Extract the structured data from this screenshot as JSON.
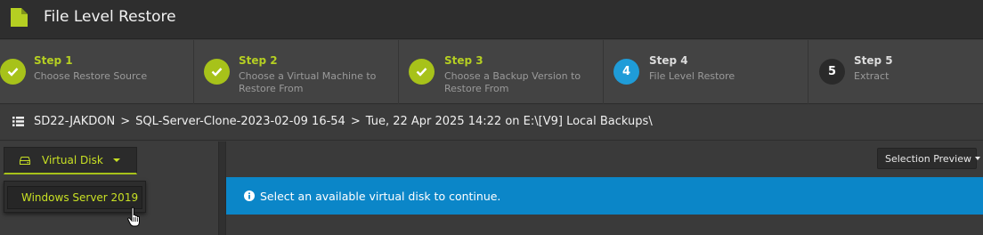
{
  "app": {
    "title": "File Level Restore",
    "icon": "document-icon",
    "accent": "#a7c21a"
  },
  "steps": [
    {
      "number": "1",
      "title": "Step 1",
      "description": "Choose Restore Source",
      "state": "done"
    },
    {
      "number": "2",
      "title": "Step 2",
      "description": "Choose a Virtual Machine to Restore From",
      "state": "done"
    },
    {
      "number": "3",
      "title": "Step 3",
      "description": "Choose a Backup Version to Restore From",
      "state": "done"
    },
    {
      "number": "4",
      "title": "Step 4",
      "description": "File Level Restore",
      "state": "active"
    },
    {
      "number": "5",
      "title": "Step 5",
      "description": "Extract",
      "state": "pending"
    }
  ],
  "breadcrumb": {
    "icon": "list-icon",
    "items": [
      "SD22-JAKDON",
      "SQL-Server-Clone-2023-02-09 16-54",
      "Tue, 22 Apr 2025 14:22 on E:\\[V9] Local Backups\\"
    ],
    "separator": ">"
  },
  "left_panel": {
    "virtual_disk_button": {
      "label": "Virtual Disk",
      "icon": "hard-drive-icon"
    },
    "dropdown_items": [
      "Windows Server 2019"
    ]
  },
  "right_panel": {
    "selection_preview_label": "Selection Preview",
    "info_message": "Select an available virtual disk to continue.",
    "info_color": "#0b86c8"
  }
}
